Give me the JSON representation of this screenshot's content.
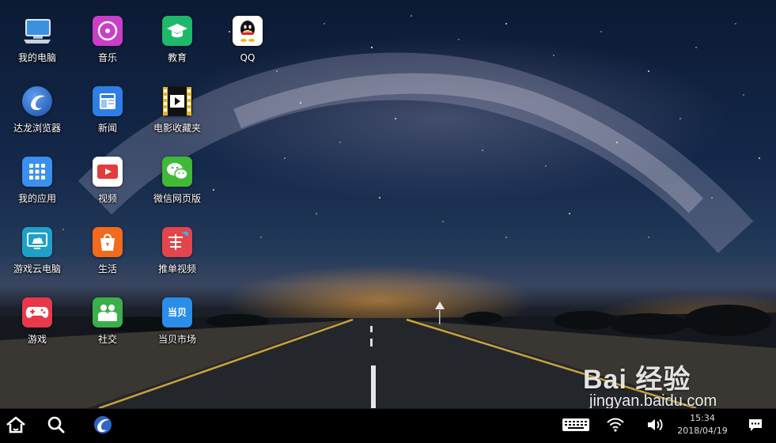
{
  "desktop": {
    "icons": [
      {
        "label": "我的电脑",
        "icon": "computer-icon",
        "color": "#2b7fd6"
      },
      {
        "label": "音乐",
        "icon": "music-icon",
        "color": "#c93fc7"
      },
      {
        "label": "教育",
        "icon": "education-icon",
        "color": "#1fb86a"
      },
      {
        "label": "QQ",
        "icon": "qq-icon",
        "color": "#ffffff"
      },
      {
        "label": "达龙浏览器",
        "icon": "browser-icon",
        "color": "#2f64c4"
      },
      {
        "label": "新闻",
        "icon": "news-icon",
        "color": "#2f7ee6"
      },
      {
        "label": "电影收藏夹",
        "icon": "film-icon",
        "color": "#e3b52a"
      },
      {
        "label": "我的应用",
        "icon": "apps-icon",
        "color": "#3b8ff0"
      },
      {
        "label": "视频",
        "icon": "video-icon",
        "color": "#ffffff"
      },
      {
        "label": "微信网页版",
        "icon": "wechat-icon",
        "color": "#3fba36"
      },
      {
        "label": "游戏云电脑",
        "icon": "cloud-pc-icon",
        "color": "#1ea0c8"
      },
      {
        "label": "生活",
        "icon": "life-icon",
        "color": "#f26a1b"
      },
      {
        "label": "推单视频",
        "icon": "tuidan-icon",
        "color": "#e2454b"
      },
      {
        "label": "游戏",
        "icon": "game-icon",
        "color": "#e8394a"
      },
      {
        "label": "社交",
        "icon": "social-icon",
        "color": "#3bb04a"
      },
      {
        "label": "当贝市场",
        "icon": "dangbei-icon",
        "color": "#2a8ee8"
      }
    ]
  },
  "taskbar": {
    "left": [
      {
        "icon": "home-icon"
      },
      {
        "icon": "search-icon"
      },
      {
        "icon": "browser-icon"
      }
    ],
    "right": [
      {
        "icon": "keyboard-icon"
      },
      {
        "icon": "wifi-icon"
      },
      {
        "icon": "volume-icon"
      },
      {
        "icon": "notification-icon"
      }
    ],
    "clock_time": "15:34",
    "clock_date": "2018/04/19"
  },
  "watermark": {
    "brand": "Bai 经验",
    "url": "jingyan.baidu.com"
  }
}
